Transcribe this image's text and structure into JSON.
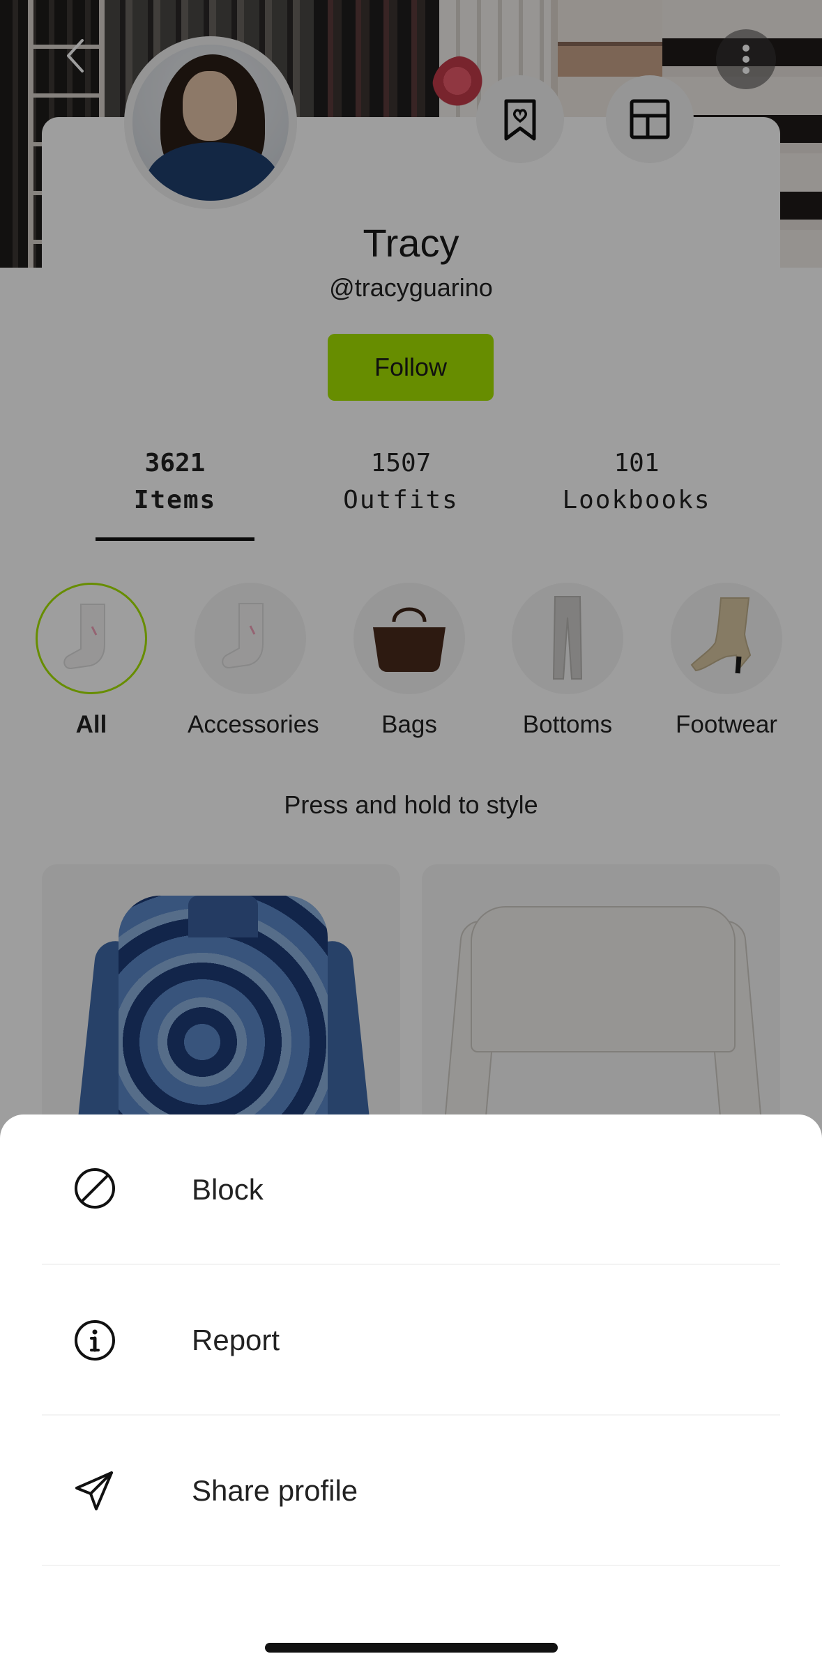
{
  "profile": {
    "name": "Tracy",
    "handle": "@tracyguarino",
    "follow_label": "Follow"
  },
  "stats": [
    {
      "value": "3621",
      "label": "Items",
      "active": true
    },
    {
      "value": "1507",
      "label": "Outfits",
      "active": false
    },
    {
      "value": "101",
      "label": "Lookbooks",
      "active": false
    }
  ],
  "categories": [
    {
      "label": "All",
      "active": true
    },
    {
      "label": "Accessories",
      "active": false
    },
    {
      "label": "Bags",
      "active": false
    },
    {
      "label": "Bottoms",
      "active": false
    },
    {
      "label": "Footwear",
      "active": false
    }
  ],
  "hint": "Press and hold to style",
  "sheet": {
    "items": [
      {
        "label": "Block",
        "icon": "block-icon"
      },
      {
        "label": "Report",
        "icon": "info-icon"
      },
      {
        "label": "Share profile",
        "icon": "send-icon"
      }
    ]
  },
  "colors": {
    "accent": "#a6e400",
    "text": "#222222",
    "scrim": "rgba(0,0,0,0.38)"
  }
}
